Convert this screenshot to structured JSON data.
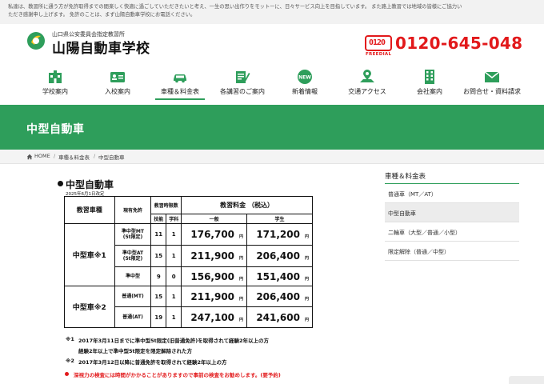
{
  "notice": {
    "line1": "私達は、教習所に通う方が免許取得までの間楽しく快適に過ごしていただきたいと考え、一生の思い出作りをモットーに、日々サービス向上を目指しています。 また路上教習では地域の皆様にご協力い",
    "line2": "ただき感謝申し上げます。 免許のことは、まず山陽自動車学校にお電話ください。"
  },
  "brand": {
    "subtitle": "山口県公安委員会指定教習所",
    "name": "山陽自動車学校"
  },
  "phone": {
    "freedial_mark": "0120",
    "freedial_label": "FREEDIAL",
    "number": "0120-645-048"
  },
  "nav": {
    "items": [
      {
        "label": "学校案内",
        "icon": "school-building-icon"
      },
      {
        "label": "入校案内",
        "icon": "id-card-icon"
      },
      {
        "label": "車種＆料金表",
        "icon": "car-icon"
      },
      {
        "label": "各講習のご案内",
        "icon": "pen-note-icon"
      },
      {
        "label": "新着情報",
        "icon": "new-badge-icon"
      },
      {
        "label": "交通アクセス",
        "icon": "map-pin-icon"
      },
      {
        "label": "会社案内",
        "icon": "office-building-icon"
      },
      {
        "label": "お問合せ・資料請求",
        "icon": "envelope-icon"
      }
    ],
    "active_index": 2
  },
  "hero": {
    "title": "中型自動車"
  },
  "breadcrumb": {
    "home": "HOME",
    "level1": "車種＆料金表",
    "level2": "中型自動車",
    "separator": "/"
  },
  "main": {
    "title": "中型自動車",
    "date_note": "2025年6月1日改定"
  },
  "table": {
    "header": {
      "course": "教習車種",
      "license": "現有免許",
      "hours": "教習時限数",
      "fee": "教習料金 （税込）",
      "skill": "技能",
      "theory": "学科",
      "general": "一般",
      "student": "学生"
    },
    "groups": [
      {
        "category": "中型車※1",
        "rows": [
          {
            "license_line1": "準中型MT",
            "license_line2": "(5t限定)",
            "skill": "11",
            "theory": "1",
            "general": "176,700",
            "student": "171,200"
          },
          {
            "license_line1": "準中型AT",
            "license_line2": "(5t限定)",
            "skill": "15",
            "theory": "1",
            "general": "211,900",
            "student": "206,400"
          },
          {
            "license_line1": "準中型",
            "license_line2": "",
            "skill": "9",
            "theory": "0",
            "general": "156,900",
            "student": "151,400"
          }
        ]
      },
      {
        "category": "中型車※2",
        "rows": [
          {
            "license_line1": "普通(MT)",
            "license_line2": "",
            "skill": "15",
            "theory": "1",
            "general": "211,900",
            "student": "206,400"
          },
          {
            "license_line1": "普通(AT)",
            "license_line2": "",
            "skill": "19",
            "theory": "1",
            "general": "247,100",
            "student": "241,600"
          }
        ]
      }
    ],
    "yen": "円"
  },
  "footnotes": {
    "n1_mark": "※1",
    "n1_line1": "2017年3月11日までに準中型5t限定(旧普通免許)を取得されて経験2年以上の方",
    "n1_line2": "経験2年以上で準中型5t限定を限定解除された方",
    "n2_mark": "※2",
    "n2_line1": "2017年3月12日以降に普通免許を取得されて経験2年以上の方",
    "red_note": "深視力の検査には時間がかかることがありますので事前の検査をお勧めします。(要予約)"
  },
  "sidebar": {
    "title": "車種＆料金表",
    "items": [
      {
        "label": "普通車（MT／AT）"
      },
      {
        "label": "中型自動車"
      },
      {
        "label": "二輪車（大型／普通／小型）"
      },
      {
        "label": "限定解除（普通／中型）"
      }
    ],
    "active_index": 1
  },
  "colors": {
    "brand_green": "#2e9e5b",
    "phone_red": "#e2191b"
  }
}
